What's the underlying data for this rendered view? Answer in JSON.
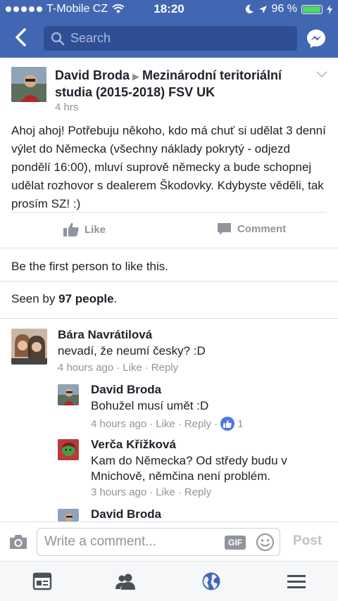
{
  "status_bar": {
    "carrier": "T-Mobile CZ",
    "time": "18:20",
    "battery": "96 %",
    "battery_level": 0.96
  },
  "nav": {
    "search_placeholder": "Search"
  },
  "post": {
    "author": "David Broda",
    "group": "Mezinárodní teritoriální studia (2015-2018) FSV UK",
    "time": "4 hrs",
    "body": "Ahoj ahoj! Potřebuju někoho, kdo má chuť si udělat 3 denní výlet do Německa (všechny náklady pokrytý - odjezd pondělí 16:00), mluví suprově německy a bude schopnej udělat rozhovor s dealerem Škodovky. Kdybyste věděli, tak prosím SZ! :)",
    "like_label": "Like",
    "comment_label": "Comment",
    "first_like": "Be the first person to like this.",
    "seen_prefix": "Seen by ",
    "seen_count": "97 people",
    "seen_suffix": "."
  },
  "comments": [
    {
      "author": "Bára Navrátilová",
      "text": "nevadí, že neumí česky? :D",
      "time": "4 hours ago",
      "like": "Like",
      "reply": "Reply"
    }
  ],
  "replies": [
    {
      "author": "David Broda",
      "text": "Bohužel musí umět :D",
      "time": "4 hours ago",
      "like": "Like",
      "reply": "Reply",
      "likes": "1"
    },
    {
      "author": "Verča Křížková",
      "text": "Kam do Německa? Od středy budu v Mnichově, němčina není problém.",
      "time": "3 hours ago",
      "like": "Like",
      "reply": "Reply"
    },
    {
      "author": "David Broda"
    }
  ],
  "composer": {
    "placeholder": "Write a comment...",
    "gif_label": "GIF",
    "post_label": "Post"
  },
  "tabbar": {
    "icons": [
      "news-feed-icon",
      "friends-icon",
      "notifications-globe-icon",
      "menu-icon"
    ]
  },
  "colors": {
    "brand": "#4267b2",
    "muted": "#90949c",
    "text": "#1d2129",
    "like_badge": "#4b78e0"
  }
}
